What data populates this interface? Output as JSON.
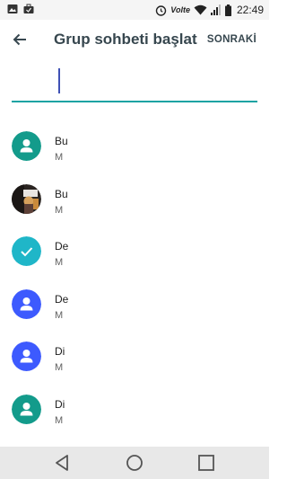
{
  "status_bar": {
    "time": "22:49",
    "network_label": "Volte",
    "icons": [
      "gallery-icon",
      "briefcase-icon",
      "alarm-icon",
      "wifi-icon",
      "signal-icon",
      "battery-icon"
    ]
  },
  "app_bar": {
    "title": "Grup sohbeti başlat",
    "next_label": "SONRAKİ",
    "back_icon": "arrow-back-icon"
  },
  "search": {
    "value": "",
    "placeholder": ""
  },
  "contacts": [
    {
      "name": "Bu",
      "subtitle": "M",
      "avatar": "person",
      "color": "#139b8b",
      "selected": false
    },
    {
      "name": "Bu",
      "subtitle": "M",
      "avatar": "photo",
      "color": "#5d4037",
      "selected": false
    },
    {
      "name": "De",
      "subtitle": "M",
      "avatar": "check",
      "color": "#1fb6c8",
      "selected": true
    },
    {
      "name": "De",
      "subtitle": "M",
      "avatar": "person",
      "color": "#3d5afe",
      "selected": false
    },
    {
      "name": "Di",
      "subtitle": "M",
      "avatar": "person",
      "color": "#3d5afe",
      "selected": false
    },
    {
      "name": "Di",
      "subtitle": "M",
      "avatar": "person",
      "color": "#139b8b",
      "selected": false
    },
    {
      "name": "",
      "subtitle": "",
      "avatar": "person",
      "color": "#1fb6c8",
      "selected": false
    }
  ],
  "nav_bar": {
    "icons": [
      "back-triangle-icon",
      "home-circle-icon",
      "recents-square-icon"
    ]
  },
  "colors": {
    "accent": "#1aa3a3",
    "caret": "#3f51b5",
    "title": "#37474f"
  }
}
